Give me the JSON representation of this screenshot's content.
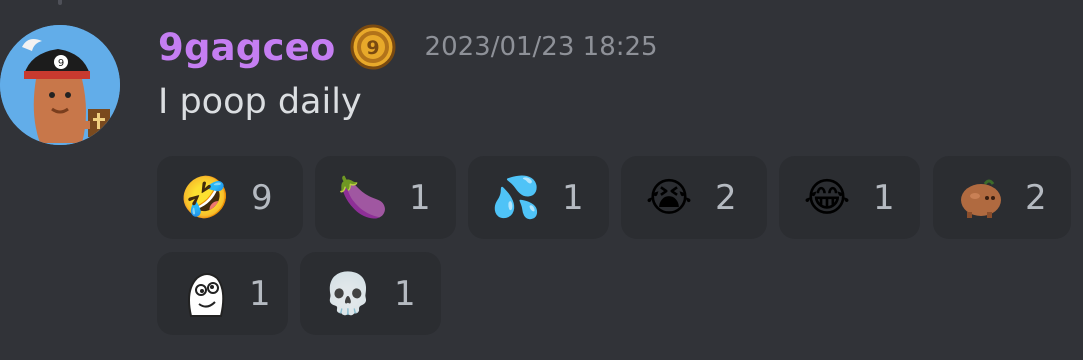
{
  "message": {
    "author": "9gagceo",
    "timestamp": "2023/01/23 18:25",
    "content": "I poop daily",
    "author_color": "#c57ef2",
    "badge_icon": "9gag-coin-icon",
    "avatar_icon": "pirate-potato-avatar"
  },
  "reactions": [
    {
      "emoji": "🤣",
      "icon": "rolling-laughing-emoji",
      "count": "9"
    },
    {
      "emoji": "🍆",
      "icon": "eggplant-emoji",
      "count": "1"
    },
    {
      "emoji": "💦",
      "icon": "sweat-droplets-emoji",
      "count": "1"
    },
    {
      "emoji": "😭",
      "icon": "loudly-crying-emoji",
      "count": "2"
    },
    {
      "emoji": "😂",
      "icon": "tears-of-joy-emoji",
      "count": "1"
    },
    {
      "emoji": "",
      "icon": "potato-custom-emoji",
      "count": "2"
    },
    {
      "emoji": "",
      "icon": "derp-face-custom-emoji",
      "count": "1"
    },
    {
      "emoji": "💀",
      "icon": "skull-emoji",
      "count": "1"
    }
  ]
}
